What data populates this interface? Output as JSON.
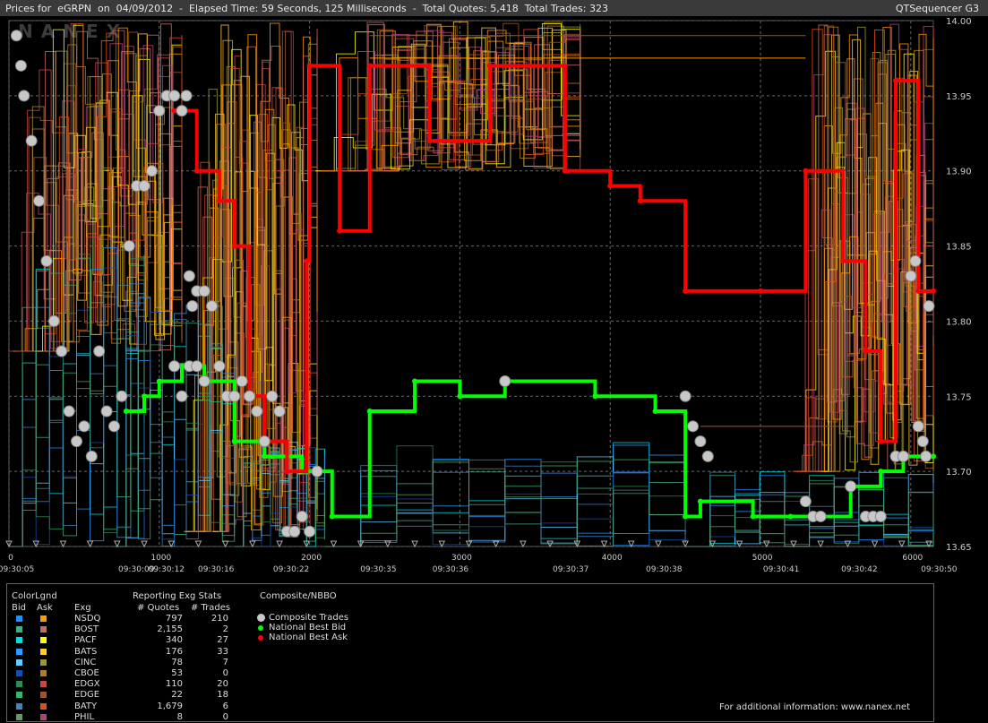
{
  "header": {
    "title_line": "Prices for  eGRPN  on  04/09/2012  -  Elapsed Time: 59 Seconds, 125 Milliseconds  -  Total Quotes: 5,418  Total Trades: 323",
    "app_name": "QTSequencer G3"
  },
  "watermark": "NANEX",
  "chart_data": {
    "type": "scatter",
    "title": "Prices for eGRPN on 04/09/2012",
    "ylim": [
      13.65,
      14.0
    ],
    "y_ticks": [
      "14.00",
      "13.95",
      "13.90",
      "13.85",
      "13.80",
      "13.75",
      "13.70",
      "13.65"
    ],
    "xlim": [
      0,
      6150
    ],
    "x_ticks": [
      "0",
      "1000",
      "2000",
      "3000",
      "4000",
      "5000",
      "6000"
    ],
    "time_labels": [
      {
        "x": 0,
        "label": "09:30:05"
      },
      {
        "x": 800,
        "label": "09:30:09"
      },
      {
        "x": 1000,
        "label": "09:30:12"
      },
      {
        "x": 1330,
        "label": "09:30:16"
      },
      {
        "x": 1830,
        "label": "09:30:22"
      },
      {
        "x": 2410,
        "label": "09:30:35"
      },
      {
        "x": 2890,
        "label": "09:30:36"
      },
      {
        "x": 3690,
        "label": "09:30:37"
      },
      {
        "x": 4310,
        "label": "09:30:38"
      },
      {
        "x": 5090,
        "label": "09:30:41"
      },
      {
        "x": 5610,
        "label": "09:30:42"
      },
      {
        "x": 6140,
        "label": "09:30:50"
      }
    ],
    "grid": true,
    "series": [
      {
        "name": "National Best Bid",
        "color": "#00ff00",
        "steps": [
          [
            780,
            13.74
          ],
          [
            900,
            13.75
          ],
          [
            1000,
            13.76
          ],
          [
            1150,
            13.77
          ],
          [
            1300,
            13.76
          ],
          [
            1500,
            13.72
          ],
          [
            1700,
            13.71
          ],
          [
            1950,
            13.7
          ],
          [
            2150,
            13.67
          ],
          [
            2400,
            13.74
          ],
          [
            2700,
            13.76
          ],
          [
            3000,
            13.75
          ],
          [
            3300,
            13.76
          ],
          [
            3900,
            13.75
          ],
          [
            4300,
            13.74
          ],
          [
            4500,
            13.67
          ],
          [
            4600,
            13.68
          ],
          [
            4950,
            13.67
          ],
          [
            5200,
            13.67
          ],
          [
            5600,
            13.69
          ],
          [
            5800,
            13.7
          ],
          [
            5950,
            13.71
          ],
          [
            6150,
            13.71
          ]
        ]
      },
      {
        "name": "National Best Ask",
        "color": "#ff0000",
        "steps": [
          [
            1100,
            13.94
          ],
          [
            1250,
            13.9
          ],
          [
            1400,
            13.88
          ],
          [
            1500,
            13.85
          ],
          [
            1600,
            13.75
          ],
          [
            1700,
            13.72
          ],
          [
            1850,
            13.7
          ],
          [
            1980,
            13.84
          ],
          [
            2000,
            13.97
          ],
          [
            2200,
            13.86
          ],
          [
            2400,
            13.97
          ],
          [
            2800,
            13.92
          ],
          [
            3200,
            13.97
          ],
          [
            3700,
            13.9
          ],
          [
            4000,
            13.89
          ],
          [
            4200,
            13.88
          ],
          [
            4500,
            13.82
          ],
          [
            5000,
            13.82
          ],
          [
            5300,
            13.9
          ],
          [
            5550,
            13.84
          ],
          [
            5700,
            13.78
          ],
          [
            5800,
            13.72
          ],
          [
            5900,
            13.96
          ],
          [
            6050,
            13.82
          ],
          [
            6150,
            13.82
          ]
        ]
      },
      {
        "name": "Composite Trades",
        "color": "#c8c8c8",
        "points": [
          [
            50,
            13.99
          ],
          [
            80,
            13.97
          ],
          [
            100,
            13.95
          ],
          [
            150,
            13.92
          ],
          [
            200,
            13.88
          ],
          [
            250,
            13.84
          ],
          [
            300,
            13.8
          ],
          [
            350,
            13.78
          ],
          [
            400,
            13.74
          ],
          [
            450,
            13.72
          ],
          [
            500,
            13.73
          ],
          [
            550,
            13.71
          ],
          [
            600,
            13.78
          ],
          [
            650,
            13.74
          ],
          [
            700,
            13.73
          ],
          [
            750,
            13.75
          ],
          [
            800,
            13.85
          ],
          [
            850,
            13.89
          ],
          [
            900,
            13.89
          ],
          [
            950,
            13.9
          ],
          [
            1000,
            13.94
          ],
          [
            1050,
            13.95
          ],
          [
            1100,
            13.95
          ],
          [
            1150,
            13.94
          ],
          [
            1180,
            13.95
          ],
          [
            1200,
            13.83
          ],
          [
            1220,
            13.81
          ],
          [
            1250,
            13.82
          ],
          [
            1300,
            13.82
          ],
          [
            1350,
            13.81
          ],
          [
            1100,
            13.77
          ],
          [
            1150,
            13.75
          ],
          [
            1200,
            13.77
          ],
          [
            1250,
            13.77
          ],
          [
            1300,
            13.76
          ],
          [
            1400,
            13.77
          ],
          [
            1450,
            13.75
          ],
          [
            1500,
            13.75
          ],
          [
            1550,
            13.76
          ],
          [
            1600,
            13.75
          ],
          [
            1650,
            13.74
          ],
          [
            1700,
            13.72
          ],
          [
            1750,
            13.75
          ],
          [
            1800,
            13.74
          ],
          [
            1850,
            13.66
          ],
          [
            1900,
            13.66
          ],
          [
            1950,
            13.67
          ],
          [
            2000,
            13.66
          ],
          [
            2050,
            13.7
          ],
          [
            3300,
            13.76
          ],
          [
            4500,
            13.75
          ],
          [
            4550,
            13.73
          ],
          [
            4600,
            13.72
          ],
          [
            4650,
            13.71
          ],
          [
            5300,
            13.68
          ],
          [
            5350,
            13.67
          ],
          [
            5400,
            13.67
          ],
          [
            5600,
            13.69
          ],
          [
            5700,
            13.67
          ],
          [
            5750,
            13.67
          ],
          [
            5800,
            13.67
          ],
          [
            5900,
            13.71
          ],
          [
            5950,
            13.71
          ],
          [
            6000,
            13.83
          ],
          [
            6030,
            13.84
          ],
          [
            6050,
            13.73
          ],
          [
            6080,
            13.72
          ],
          [
            6100,
            13.71
          ],
          [
            6120,
            13.81
          ]
        ]
      }
    ]
  },
  "legend": {
    "col_headers": {
      "colorlegend": "ColorLgnd",
      "bid": "Bid",
      "ask": "Ask",
      "stats": "Reporting Exg Stats",
      "exg": "Exg",
      "quotes": "# Quotes",
      "trades": "# Trades",
      "composite": "Composite/NBBO"
    },
    "rows": [
      {
        "exg": "NSDQ",
        "quotes": "797",
        "trades": "210",
        "bid_color": "#1e90ff",
        "ask_color": "#ff9900"
      },
      {
        "exg": "BOST",
        "quotes": "2,155",
        "trades": "2",
        "bid_color": "#40b080",
        "ask_color": "#cc6666"
      },
      {
        "exg": "PACF",
        "quotes": "340",
        "trades": "27",
        "bid_color": "#00e0e0",
        "ask_color": "#ffff00"
      },
      {
        "exg": "BATS",
        "quotes": "176",
        "trades": "33",
        "bid_color": "#3399ff",
        "ask_color": "#ffcc33"
      },
      {
        "exg": "CINC",
        "quotes": "78",
        "trades": "7",
        "bid_color": "#66ccff",
        "ask_color": "#999933"
      },
      {
        "exg": "CBOE",
        "quotes": "53",
        "trades": "0",
        "bid_color": "#1a4da8",
        "ask_color": "#b08020"
      },
      {
        "exg": "EDGX",
        "quotes": "110",
        "trades": "20",
        "bid_color": "#2e8b57",
        "ask_color": "#cc4444"
      },
      {
        "exg": "EDGE",
        "quotes": "22",
        "trades": "18",
        "bid_color": "#3cb371",
        "ask_color": "#a0522d"
      },
      {
        "exg": "BATY",
        "quotes": "1,679",
        "trades": "6",
        "bid_color": "#4682b4",
        "ask_color": "#e05010"
      },
      {
        "exg": "PHIL",
        "quotes": "8",
        "trades": "0",
        "bid_color": "#669966",
        "ask_color": "#b04080"
      }
    ],
    "nbbo_items": [
      {
        "label": "Composite Trades",
        "color": "#c8c8c8",
        "icon": "circle-large"
      },
      {
        "label": "National Best Bid",
        "color": "#00ff00",
        "icon": "circle-small"
      },
      {
        "label": "National Best Ask",
        "color": "#ff0000",
        "icon": "circle-small"
      }
    ],
    "footer": "For additional information: www.nanex.net"
  }
}
